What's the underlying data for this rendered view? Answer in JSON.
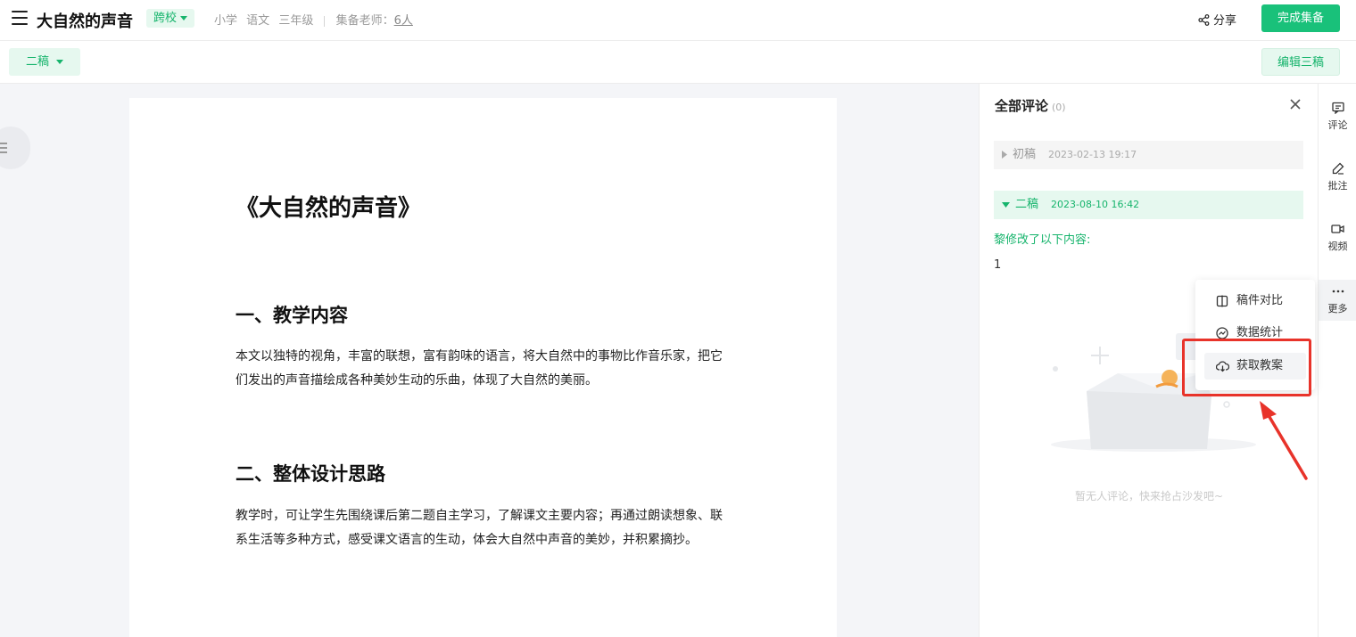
{
  "header": {
    "title": "大自然的声音",
    "badge": "跨校",
    "meta": [
      "小学",
      "语文",
      "三年级"
    ],
    "teachers_label": "集备老师：",
    "teachers_count": "6人",
    "share_label": "分享",
    "finish_label": "完成集备"
  },
  "subbar": {
    "draft_label": "二稿",
    "edit_label": "编辑三稿"
  },
  "document": {
    "title": "《大自然的声音》",
    "section1_heading": "一、教学内容",
    "section1_text": "本文以独特的视角，丰富的联想，富有韵味的语言，将大自然中的事物比作音乐家，把它们发出的声音描绘成各种美妙生动的乐曲，体现了大自然的美丽。",
    "section2_heading": "二、整体设计思路",
    "section2_text": "教学时，可让学生先围绕课后第二题自主学习，了解课文主要内容；再通过朗读想象、联系生活等多种方式，感受课文语言的生动，体会大自然中声音的美妙，并积累摘抄。"
  },
  "comments": {
    "title": "全部评论",
    "count": "(0)",
    "versions": [
      {
        "label": "初稿",
        "date": "2023-02-13 19:17"
      },
      {
        "label": "二稿",
        "date": "2023-08-10 16:42"
      }
    ],
    "modified_text": "黎修改了以下内容:",
    "modified_value": "1",
    "empty_text": "暂无人评论，快来抢占沙发吧~"
  },
  "toolbar": {
    "items": [
      {
        "label": "评论",
        "icon": "comment-icon"
      },
      {
        "label": "批注",
        "icon": "pen-icon"
      },
      {
        "label": "视频",
        "icon": "video-icon"
      },
      {
        "label": "更多",
        "icon": "more-icon"
      }
    ]
  },
  "more_menu": {
    "items": [
      {
        "label": "稿件对比",
        "icon": "compare-icon"
      },
      {
        "label": "数据统计",
        "icon": "stats-icon"
      },
      {
        "label": "获取教案",
        "icon": "cloud-download-icon"
      }
    ]
  },
  "colors": {
    "accent": "#19c17a",
    "accent_light": "#e6f8ef",
    "highlight": "#e8332a"
  }
}
